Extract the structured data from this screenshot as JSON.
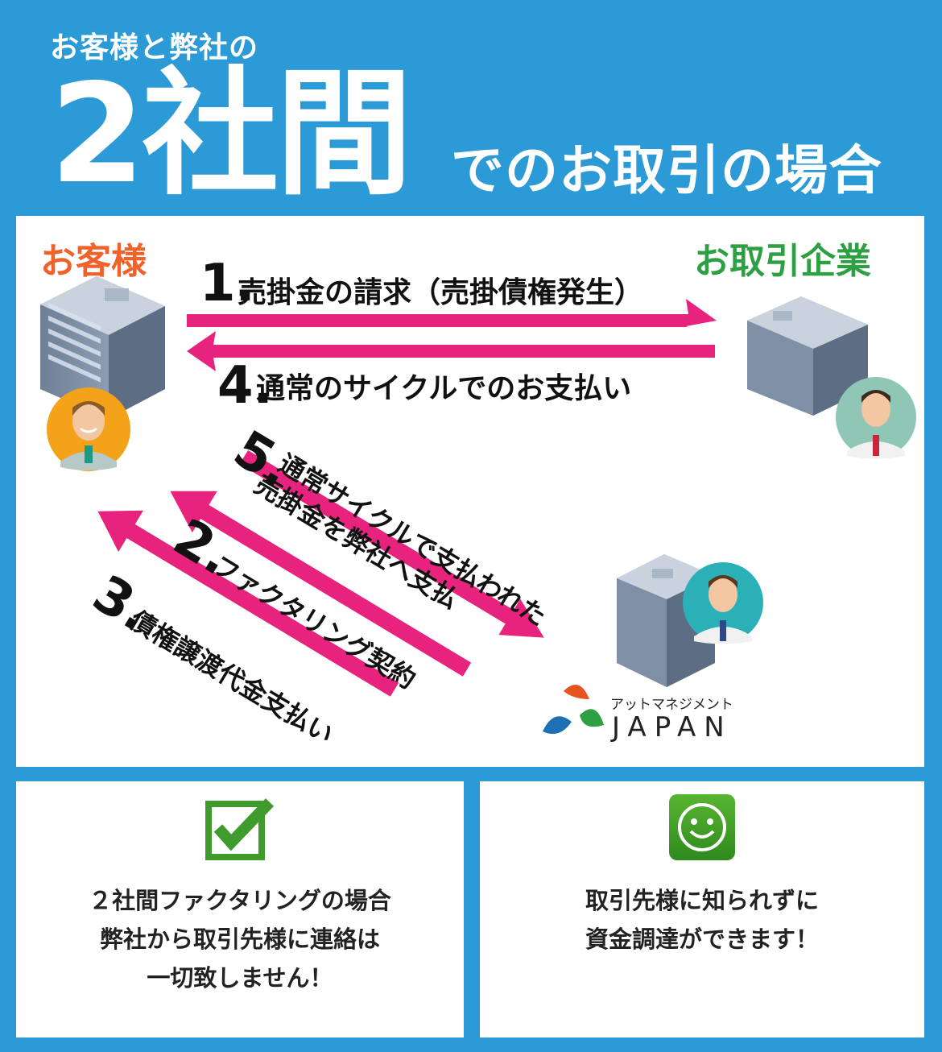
{
  "header": {
    "subtitle": "お客様と弊社の",
    "title_big": "2社間",
    "title_rest": "でのお取引の場合"
  },
  "diagram": {
    "customer_label": "お客様",
    "partner_label": "お取引企業",
    "steps": {
      "s1_num": "1.",
      "s1_text": "売掛金の請求（売掛債権発生）",
      "s4_num": "4.",
      "s4_text": "通常のサイクルでのお支払い",
      "s5_num": "5.",
      "s5_line1": "通常サイクルで支払われた",
      "s5_line2": "売掛金を弊社へ支払",
      "s2_num": "2.",
      "s2_text": "ファクタリング契約",
      "s3_num": "3.",
      "s3_text": "債権譲渡代金支払い"
    },
    "logo": {
      "kana": "アットマネジメント",
      "name": "JAPAN"
    },
    "colors": {
      "arrow": "#e8237e",
      "customer_label": "#f0622a",
      "partner_label": "#2ea043",
      "background": "#2b9ad6"
    }
  },
  "cards": {
    "left": {
      "icon": "checkbox-icon",
      "lines": [
        "２社間ファクタリングの場合",
        "弊社から取引先様に連絡は",
        "一切致しません！"
      ]
    },
    "right": {
      "icon": "smiley-icon",
      "lines": [
        "取引先様に知られずに",
        "資金調達ができます！"
      ]
    }
  }
}
